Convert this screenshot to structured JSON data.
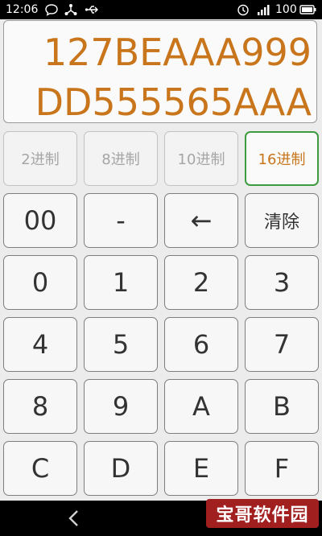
{
  "status_bar": {
    "time": "12:06",
    "battery_percent": "100",
    "left_icons": [
      "chat-bubble-icon",
      "share-icon",
      "usb-icon"
    ],
    "right_icons": [
      "alarm-icon",
      "signal-icon",
      "battery-icon"
    ]
  },
  "display": {
    "line1": "127BEAAA999",
    "line2": "DD555565AAA",
    "text_color": "#c8751b"
  },
  "base_tabs": [
    {
      "label": "2进制",
      "active": false
    },
    {
      "label": "8进制",
      "active": false
    },
    {
      "label": "10进制",
      "active": false
    },
    {
      "label": "16进制",
      "active": true
    }
  ],
  "keys": {
    "row1": [
      "00",
      "-",
      "←",
      "清除"
    ],
    "row2": [
      "0",
      "1",
      "2",
      "3"
    ],
    "row3": [
      "4",
      "5",
      "6",
      "7"
    ],
    "row4": [
      "8",
      "9",
      "A",
      "B"
    ],
    "row5": [
      "C",
      "D",
      "E",
      "F"
    ]
  },
  "nav": {
    "back_icon": "back-chevron-icon"
  },
  "watermark": {
    "text": "宝哥软件园"
  }
}
